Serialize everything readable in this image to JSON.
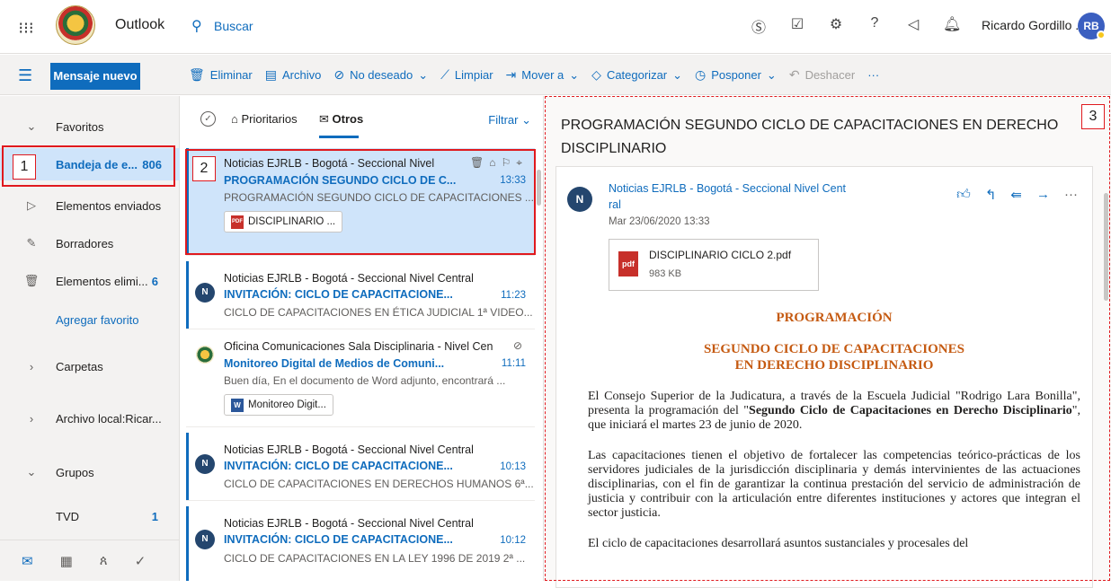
{
  "topbar": {
    "app_name": "Outlook",
    "search_placeholder": "Buscar",
    "user_name": "Ricardo Gordillo ..",
    "avatar_initials": "RB",
    "icons": [
      "skype-icon",
      "to-do-icon",
      "settings-icon",
      "help-icon",
      "feedback-icon",
      "notifications-icon"
    ]
  },
  "commands": {
    "new_message": "Mensaje nuevo",
    "delete": "Eliminar",
    "archive": "Archivo",
    "junk": "No deseado",
    "sweep": "Limpiar",
    "move_to": "Mover a",
    "categorize": "Categorizar",
    "snooze": "Posponer",
    "undo": "Deshacer",
    "more": "···"
  },
  "nav": {
    "favorites": "Favoritos",
    "inbox": "Bandeja de e...",
    "inbox_count": "806",
    "sent": "Elementos enviados",
    "drafts": "Borradores",
    "deleted": "Elementos elimi...",
    "deleted_count": "6",
    "add_favorite": "Agregar favorito",
    "folders": "Carpetas",
    "local_archive": "Archivo local:Ricar...",
    "groups": "Grupos",
    "tvd": "TVD",
    "tvd_count": "1"
  },
  "list": {
    "tab_focused": "Prioritarios",
    "tab_other": "Otros",
    "filter": "Filtrar",
    "messages": [
      {
        "sender": "Noticias EJRLB - Bogotá - Seccional Nivel",
        "subject": "PROGRAMACIÓN SEGUNDO CICLO DE C...",
        "time": "13:33",
        "preview": "PROGRAMACIÓN SEGUNDO CICLO DE CAPACITACIONES ...",
        "attachment": "DISCIPLINARIO ..."
      },
      {
        "avatar": "N",
        "sender": "Noticias EJRLB - Bogotá - Seccional Nivel Central",
        "subject": "INVITACIÓN: CICLO DE CAPACITACIONE...",
        "time": "11:23",
        "preview": "CICLO DE CAPACITACIONES EN ÉTICA JUDICIAL 1ª VIDEO..."
      },
      {
        "sender": "Oficina Comunicaciones Sala Disciplinaria - Nivel Cen",
        "subject": "Monitoreo Digital de Medios de Comuni...",
        "time": "11:11",
        "preview": "Buen día, En el documento de Word adjunto, encontrará ...",
        "attachment": "Monitoreo Digit..."
      },
      {
        "avatar": "N",
        "sender": "Noticias EJRLB - Bogotá - Seccional Nivel Central",
        "subject": "INVITACIÓN: CICLO DE CAPACITACIONE...",
        "time": "10:13",
        "preview": "CICLO DE CAPACITACIONES EN DERECHOS HUMANOS 6ª..."
      },
      {
        "avatar": "N",
        "sender": "Noticias EJRLB - Bogotá - Seccional Nivel Central",
        "subject": "INVITACIÓN: CICLO DE CAPACITACIONE...",
        "time": "10:12",
        "preview": "CICLO DE CAPACITACIONES EN LA LEY 1996 DE 2019 2ª ..."
      }
    ]
  },
  "reading": {
    "title": "PROGRAMACIÓN SEGUNDO CICLO DE CAPACITACIONES EN DERECHO DISCIPLINARIO",
    "avatar": "N",
    "from_line1": "Noticias EJRLB - Bogotá - Seccional Nivel Cent",
    "from_line2": "ral",
    "date": "Mar 23/06/2020 13:33",
    "attachment_name": "DISCIPLINARIO CICLO 2.pdf",
    "attachment_size": "983 KB",
    "heading": "PROGRAMACIÓN",
    "subheading_1": "SEGUNDO CICLO DE CAPACITACIONES",
    "subheading_2": "EN DERECHO DISCIPLINARIO",
    "p1_a": "El Consejo Superior de la Judicatura, a través de la Escuela Judicial \"Rodrigo Lara Bonilla\", presenta la programación del \"",
    "p1_b": "Segundo Ciclo de Capacitaciones en Derecho Disciplinario",
    "p1_c": "\", que iniciará el martes 23 de junio de 2020.",
    "p2": "Las capacitaciones tienen el objetivo de fortalecer las competencias teórico-prácticas de los servidores judiciales de la jurisdicción disciplinaria y demás intervinientes de las actuaciones disciplinarias, con el fin de garantizar la continua prestación del servicio de administración de justicia y contribuir con la articulación entre diferentes instituciones y actores que integran el sector justicia.",
    "p3": "El ciclo de capacitaciones desarrollará asuntos sustanciales y procesales del"
  },
  "annotations": {
    "label_1": "1",
    "label_2": "2",
    "label_3": "3"
  },
  "colors": {
    "accent": "#0f6cbd",
    "highlight": "#e0191e",
    "heading": "#c55a11"
  }
}
